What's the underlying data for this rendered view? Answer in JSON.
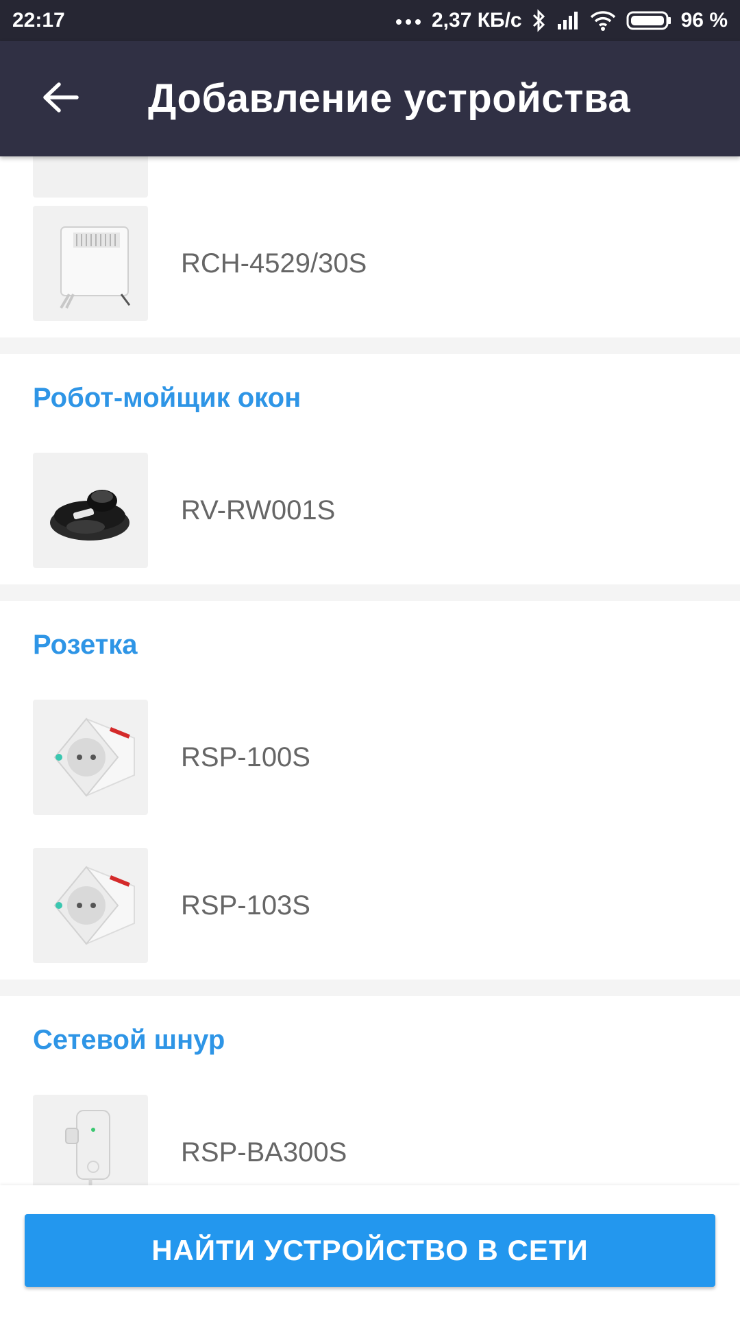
{
  "status_bar": {
    "time": "22:17",
    "network_speed": "2,37 КБ/с",
    "battery": "96 %",
    "icons": [
      "more-dots-icon",
      "bluetooth-icon",
      "signal-icon",
      "wifi-icon",
      "battery-icon"
    ]
  },
  "app_bar": {
    "back_icon": "arrow-left-icon",
    "title": "Добавление устройства"
  },
  "categories": [
    {
      "title": "",
      "items": [
        {
          "model": "RCH-4529/30S",
          "icon": "convector-heater-image"
        }
      ]
    },
    {
      "title": "Робот-мойщик окон",
      "items": [
        {
          "model": "RV-RW001S",
          "icon": "window-robot-image"
        }
      ]
    },
    {
      "title": "Розетка",
      "items": [
        {
          "model": "RSP-100S",
          "icon": "smart-socket-image"
        },
        {
          "model": "RSP-103S",
          "icon": "smart-socket-image"
        }
      ]
    },
    {
      "title": "Сетевой шнур",
      "items": [
        {
          "model": "RSP-BA300S",
          "icon": "smart-plug-cord-image"
        }
      ]
    }
  ],
  "find_button": {
    "label": "НАЙТИ УСТРОЙСТВО В СЕТИ"
  },
  "colors": {
    "status_bar_bg": "#262633",
    "app_bar_bg": "#303044",
    "category_title": "#2e95e6",
    "button_bg": "#2397ee",
    "item_text": "#666666"
  }
}
